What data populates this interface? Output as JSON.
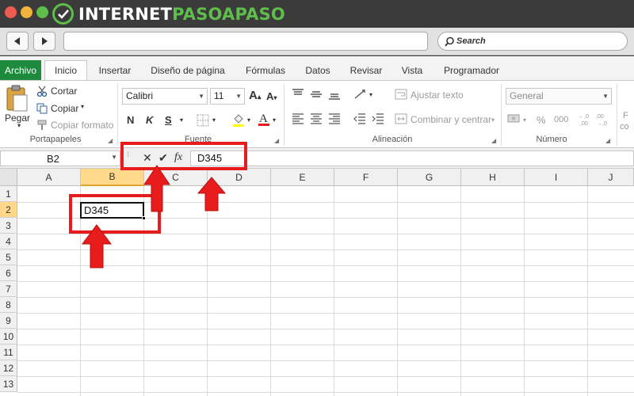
{
  "logo": {
    "text_part1": "INTERNET",
    "text_part2": "PASOAPASO"
  },
  "browser": {
    "search_placeholder": "Search"
  },
  "ribbon_tabs": [
    "Archivo",
    "Inicio",
    "Insertar",
    "Diseño de página",
    "Fórmulas",
    "Datos",
    "Revisar",
    "Vista",
    "Programador"
  ],
  "clipboard": {
    "paste": "Pegar",
    "cut": "Cortar",
    "copy": "Copiar",
    "format_painter": "Copiar formato",
    "group_label": "Portapapeles"
  },
  "font": {
    "family": "Calibri",
    "size": "11",
    "bold": "N",
    "italic": "K",
    "underline": "S",
    "group_label": "Fuente"
  },
  "alignment": {
    "wrap_text": "Ajustar texto",
    "merge_center": "Combinar y centrar",
    "group_label": "Alineación"
  },
  "number": {
    "format": "General",
    "percent": "%",
    "thousands": "000",
    "group_label": "Número"
  },
  "partial_right": {
    "line1": "F",
    "line2": "co"
  },
  "formula_bar": {
    "name_box": "B2",
    "cancel_symbol": "✕",
    "enter_symbol": "✔",
    "fx_label": "fx",
    "value": "D345"
  },
  "grid": {
    "columns": [
      "A",
      "B",
      "C",
      "D",
      "E",
      "F",
      "G",
      "H",
      "I",
      "J"
    ],
    "rows": [
      "1",
      "2",
      "3",
      "4",
      "5",
      "6",
      "7",
      "8",
      "9",
      "10",
      "11",
      "12",
      "13"
    ],
    "selected_column": "B",
    "selected_row": "2",
    "active_cell_value": "D345"
  },
  "colors": {
    "archivo_green": "#1e8a3e",
    "annotation_red": "#e81c1c",
    "selected_header": "#ffd88a"
  }
}
